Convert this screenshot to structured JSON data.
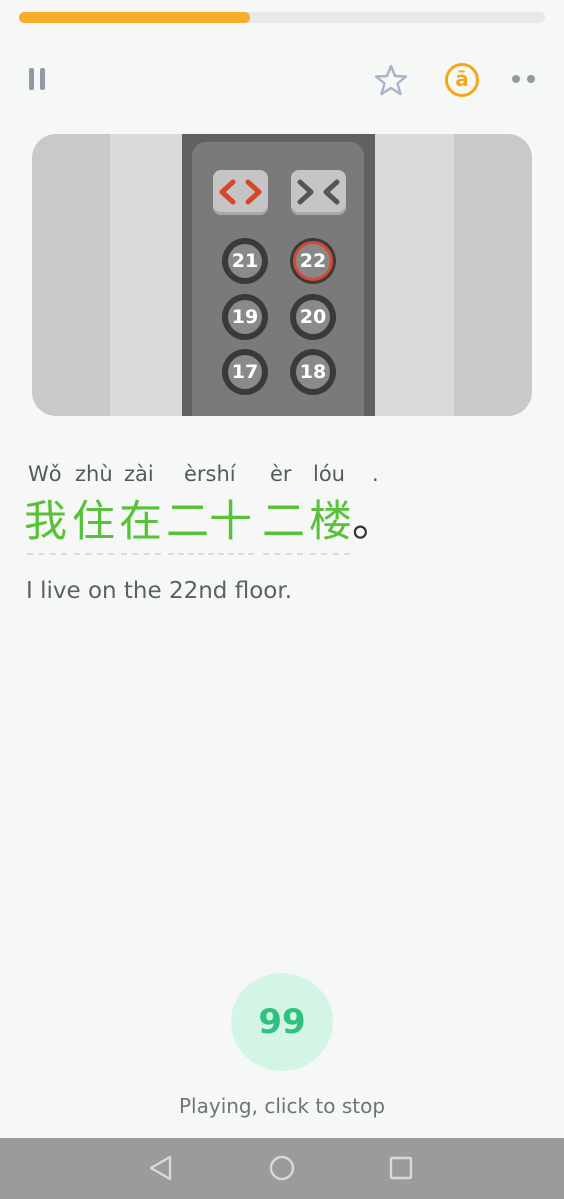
{
  "progress": {
    "fraction": 0.44
  },
  "toolbar": {
    "pause_icon": "pause-icon",
    "star_icon": "star-icon",
    "pinyin_toggle_label": "ā",
    "more_icon": "more-icon"
  },
  "illustration": {
    "door_buttons": [
      "open-door-icon",
      "close-door-icon"
    ],
    "floor_buttons": [
      "21",
      "22",
      "19",
      "20",
      "17",
      "18"
    ],
    "active_floor": "22"
  },
  "sentence": {
    "pinyin": [
      "Wǒ",
      "zhù",
      "zài",
      "èrshí",
      "èr",
      "lóu",
      "."
    ],
    "hanzi": [
      "我",
      "住",
      "在",
      "二十",
      "二",
      "楼",
      "。"
    ],
    "translation": "I live on the 22nd floor."
  },
  "playback": {
    "icon_label": "99",
    "status": "Playing, click to stop"
  },
  "navbar": [
    "back-icon",
    "home-icon",
    "recents-icon"
  ],
  "colors": {
    "progress": "#f8ad2a",
    "accent_orange": "#f6a719",
    "hanzi_green": "#59c137",
    "play_bg": "#d3f5e5",
    "play_fg": "#2ec27e",
    "active_floor_ring": "#d24a33"
  }
}
